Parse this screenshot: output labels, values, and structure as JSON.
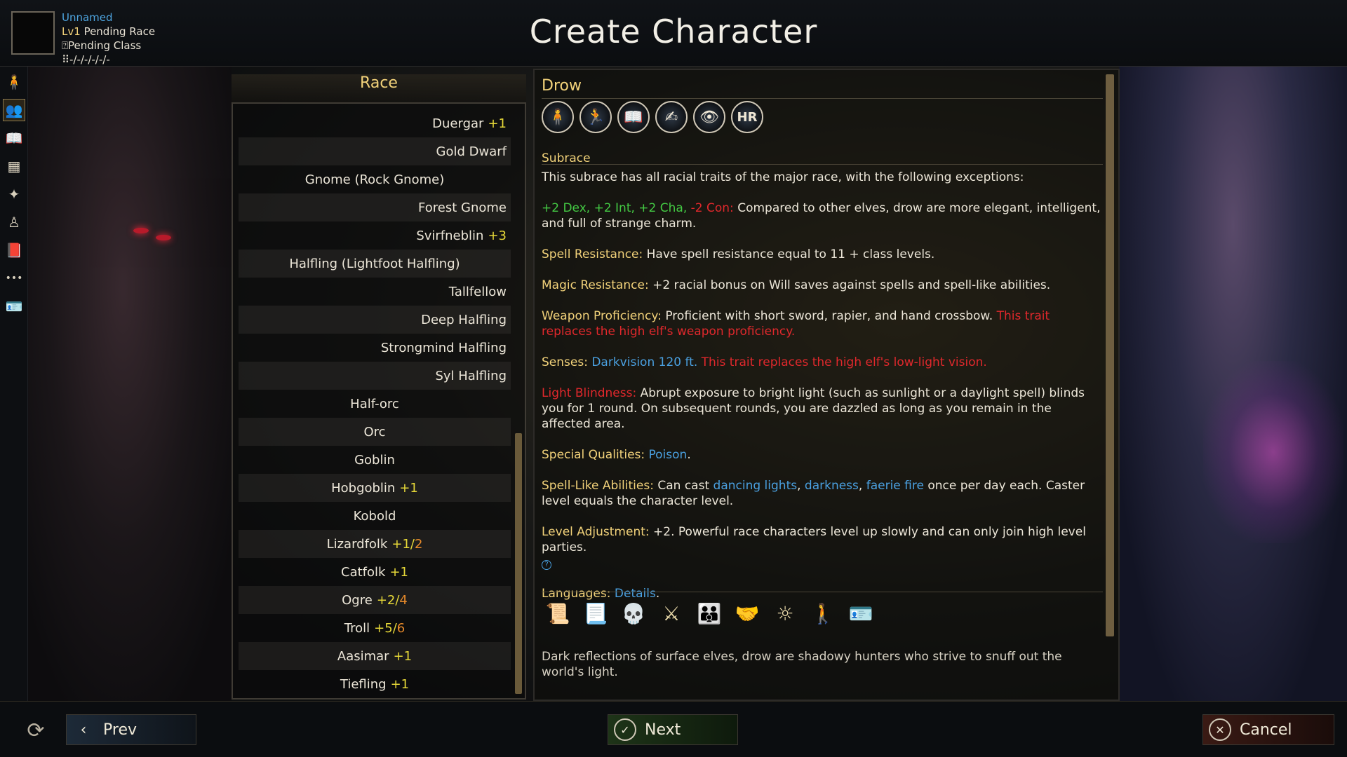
{
  "page_title": "Create Character",
  "character": {
    "name": "Unnamed",
    "level_prefix": "Lv1",
    "race": "Pending Race",
    "class_glyph": "⍰",
    "class": "Pending Class",
    "stats_glyph": "⠿",
    "stats": "-/-/-/-/-/-"
  },
  "side_rail": [
    {
      "icon": "person-icon",
      "glyph": "🧍"
    },
    {
      "icon": "race-icon",
      "glyph": "👥"
    },
    {
      "icon": "book-icon",
      "glyph": "📖"
    },
    {
      "icon": "grid-icon",
      "glyph": "▦"
    },
    {
      "icon": "abilities-icon",
      "glyph": "✦"
    },
    {
      "icon": "figure-icon",
      "glyph": "♙"
    },
    {
      "icon": "tome-icon",
      "glyph": "📕"
    },
    {
      "icon": "more-icon",
      "glyph": "•••"
    },
    {
      "icon": "portrait-card-icon",
      "glyph": "🪪"
    }
  ],
  "race_panel": {
    "title": "Race",
    "items": [
      {
        "name": "Duergar",
        "bonus": "+1",
        "bonus_alt": "",
        "align": "right"
      },
      {
        "name": "Gold Dwarf",
        "bonus": "",
        "bonus_alt": "",
        "align": "right"
      },
      {
        "name": "Gnome (Rock Gnome)",
        "bonus": "",
        "bonus_alt": "",
        "align": "center"
      },
      {
        "name": "Forest Gnome",
        "bonus": "",
        "bonus_alt": "",
        "align": "right"
      },
      {
        "name": "Svirfneblin",
        "bonus": "+3",
        "bonus_alt": "",
        "align": "right"
      },
      {
        "name": "Halfling (Lightfoot Halfling)",
        "bonus": "",
        "bonus_alt": "",
        "align": "center"
      },
      {
        "name": "Tallfellow",
        "bonus": "",
        "bonus_alt": "",
        "align": "right"
      },
      {
        "name": "Deep Halfling",
        "bonus": "",
        "bonus_alt": "",
        "align": "right"
      },
      {
        "name": "Strongmind Halfling",
        "bonus": "",
        "bonus_alt": "",
        "align": "right"
      },
      {
        "name": "Syl Halfling",
        "bonus": "",
        "bonus_alt": "",
        "align": "right"
      },
      {
        "name": "Half-orc",
        "bonus": "",
        "bonus_alt": "",
        "align": "center"
      },
      {
        "name": "Orc",
        "bonus": "",
        "bonus_alt": "",
        "align": "center"
      },
      {
        "name": "Goblin",
        "bonus": "",
        "bonus_alt": "",
        "align": "center"
      },
      {
        "name": "Hobgoblin",
        "bonus": "+1",
        "bonus_alt": "",
        "align": "center"
      },
      {
        "name": "Kobold",
        "bonus": "",
        "bonus_alt": "",
        "align": "center"
      },
      {
        "name": "Lizardfolk",
        "bonus": "+1/",
        "bonus_alt": "2",
        "align": "center"
      },
      {
        "name": "Catfolk",
        "bonus": "+1",
        "bonus_alt": "",
        "align": "center"
      },
      {
        "name": "Ogre",
        "bonus": "+2/",
        "bonus_alt": "4",
        "align": "center"
      },
      {
        "name": "Troll",
        "bonus": "+5/",
        "bonus_alt": "6",
        "align": "center"
      },
      {
        "name": "Aasimar",
        "bonus": "+1",
        "bonus_alt": "",
        "align": "center"
      },
      {
        "name": "Tiefling",
        "bonus": "+1",
        "bonus_alt": "",
        "align": "center"
      }
    ]
  },
  "detail": {
    "title": "Drow",
    "trait_icons": [
      {
        "icon": "humanoid-icon",
        "glyph": "🧍"
      },
      {
        "icon": "running-speed-icon",
        "glyph": "🏃"
      },
      {
        "icon": "open-book-icon",
        "glyph": "📖"
      },
      {
        "icon": "hand-scroll-icon",
        "glyph": "✍"
      },
      {
        "icon": "eye-icon",
        "glyph": "👁"
      },
      {
        "icon": "hr-badge-icon",
        "glyph": "HR"
      }
    ],
    "subrace_heading": "Subrace",
    "intro": "This subrace has all racial traits of the major race, with the following exceptions:",
    "stats_line": {
      "green": "+2 Dex, +2 Int, +2 Cha,",
      "red": "-2 Con:",
      "text": "Compared to other elves, drow are more elegant, intelligent, and full of strange charm."
    },
    "spell_resistance": {
      "key": "Spell Resistance:",
      "text": "Have spell resistance equal to 11 + class levels."
    },
    "magic_resistance": {
      "key": "Magic Resistance:",
      "text": "+2 racial bonus on Will saves against spells and spell-like abilities."
    },
    "weapon_proficiency": {
      "key": "Weapon Proficiency:",
      "text": "Proficient with short sword, rapier, and hand crossbow.",
      "red": "This trait replaces the high elf's weapon proficiency."
    },
    "senses": {
      "key": "Senses:",
      "blue": "Darkvision 120 ft.",
      "red": "This trait replaces the high elf's low-light vision."
    },
    "light_blindness": {
      "key": "Light Blindness:",
      "text": "Abrupt exposure to bright light (such as sunlight or a daylight spell) blinds you for 1 round. On subsequent rounds, you are dazzled as long as you remain in the affected area."
    },
    "special_qualities": {
      "key": "Special Qualities:",
      "blue": "Poison",
      "end": "."
    },
    "spell_like": {
      "key": "Spell-Like Abilities:",
      "lead": "Can cast",
      "spell1": "dancing lights",
      "sep1": ",",
      "spell2": "darkness",
      "sep2": ",",
      "spell3": "faerie fire",
      "tail": "once per day each. Caster level equals the character level."
    },
    "level_adjustment": {
      "key": "Level Adjustment:",
      "text": "+2. Powerful race characters level up slowly and can only join high level parties.",
      "info": "?"
    },
    "languages": {
      "key": "Languages:",
      "blue": "Details",
      "end": "."
    },
    "feature_icons": [
      {
        "icon": "scroll-icon",
        "glyph": "📜"
      },
      {
        "icon": "parchment-icon",
        "glyph": "📃"
      },
      {
        "icon": "skeleton-heart-icon",
        "glyph": "💀"
      },
      {
        "icon": "crossed-swords-icon",
        "glyph": "⚔"
      },
      {
        "icon": "crowd-icon",
        "glyph": "👪"
      },
      {
        "icon": "handshake-icon",
        "glyph": "🤝"
      },
      {
        "icon": "radiant-figure-icon",
        "glyph": "☼"
      },
      {
        "icon": "explorer-icon",
        "glyph": "🚶"
      },
      {
        "icon": "id-card-icon",
        "glyph": "🪪"
      }
    ],
    "flavor": "Dark reflections of surface elves, drow are shadowy hunters who strive to snuff out the world's light."
  },
  "bottom_bar": {
    "refresh_glyph": "⟳",
    "prev": {
      "label": "Prev",
      "glyph": "‹"
    },
    "next": {
      "label": "Next",
      "glyph": "✓"
    },
    "cancel": {
      "label": "Cancel",
      "glyph": "✕"
    }
  },
  "colors": {
    "accent_gold": "#f2d27a",
    "bonus_yellow": "#e6d838",
    "bonus_orange": "#e88a2a",
    "link_blue": "#4aa0e0",
    "warn_red": "#e0282c",
    "stat_green": "#43c943"
  }
}
